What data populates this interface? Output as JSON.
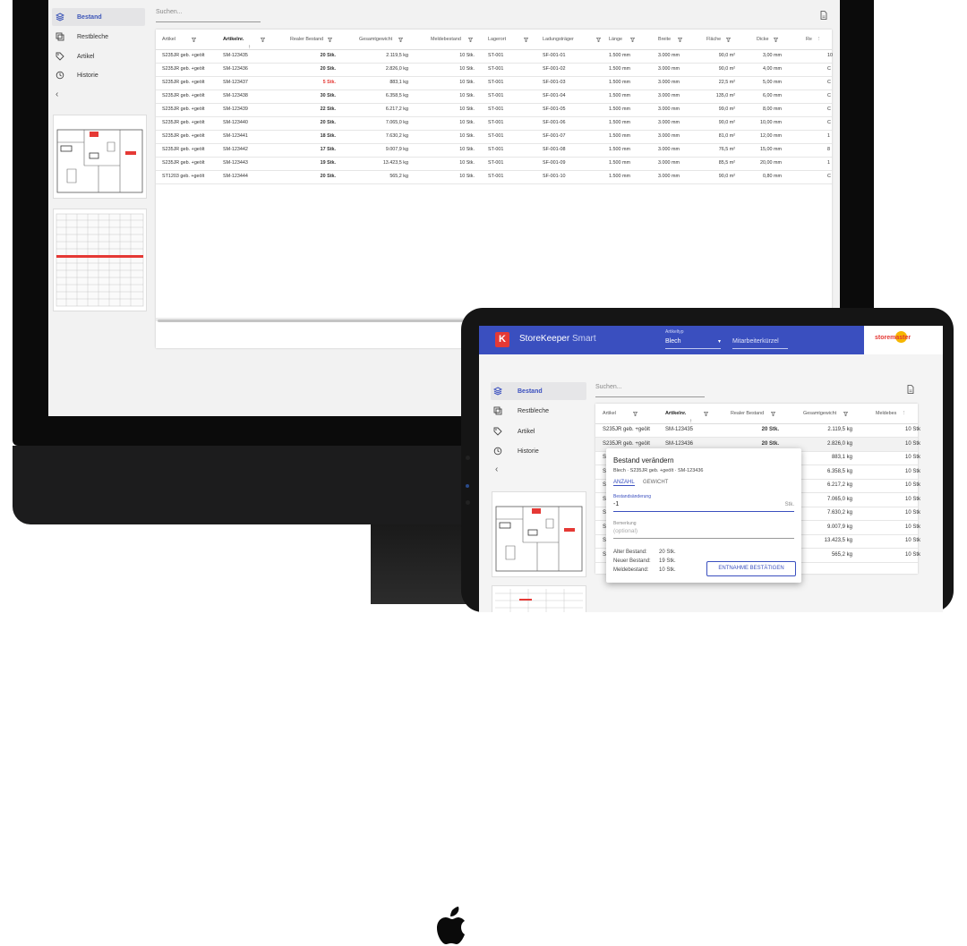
{
  "nav": [
    {
      "label": "Bestand",
      "icon": "layers-icon",
      "active": true
    },
    {
      "label": "Restbleche",
      "icon": "copy-icon",
      "active": false
    },
    {
      "label": "Artikel",
      "icon": "tag-icon",
      "active": false
    },
    {
      "label": "Historie",
      "icon": "history-icon",
      "active": false
    }
  ],
  "collapse_glyph": "‹",
  "search_placeholder": "Suchen...",
  "columns": [
    "Artikel",
    "Artikelnr.",
    "Realer Bestand",
    "Gesamtgewicht",
    "Meldebestand",
    "Lagerort",
    "Ladungsträger",
    "Länge",
    "Breite",
    "Fläche",
    "Dicke",
    "Re"
  ],
  "ipad_columns": [
    "Artikel",
    "Artikelnr.",
    "Realer Bestand",
    "Gesamtgewicht",
    "Meldebes"
  ],
  "rows": [
    {
      "artikel": "S235JR geb. +geölt",
      "nr": "SM-123435",
      "bestand": "20 Stk.",
      "gewicht": "2.119,5 kg",
      "melde": "10 Stk.",
      "lagerort": "ST-001",
      "traeger": "SF-001-01",
      "laenge": "1.500 mm",
      "breite": "3.000 mm",
      "flaeche": "90,0 m²",
      "dicke": "3,00 mm",
      "re": "10",
      "low": false
    },
    {
      "artikel": "S235JR geb. +geölt",
      "nr": "SM-123436",
      "bestand": "20 Stk.",
      "gewicht": "2.826,0 kg",
      "melde": "10 Stk.",
      "lagerort": "ST-001",
      "traeger": "SF-001-02",
      "laenge": "1.500 mm",
      "breite": "3.000 mm",
      "flaeche": "90,0 m²",
      "dicke": "4,00 mm",
      "re": "C",
      "low": false
    },
    {
      "artikel": "S235JR geb. +geölt",
      "nr": "SM-123437",
      "bestand": "5 Stk.",
      "gewicht": "883,1 kg",
      "melde": "10 Stk.",
      "lagerort": "ST-001",
      "traeger": "SF-001-03",
      "laenge": "1.500 mm",
      "breite": "3.000 mm",
      "flaeche": "22,5 m²",
      "dicke": "5,00 mm",
      "re": "C",
      "low": true
    },
    {
      "artikel": "S235JR geb. +geölt",
      "nr": "SM-123438",
      "bestand": "30 Stk.",
      "gewicht": "6.358,5 kg",
      "melde": "10 Stk.",
      "lagerort": "ST-001",
      "traeger": "SF-001-04",
      "laenge": "1.500 mm",
      "breite": "3.000 mm",
      "flaeche": "135,0 m²",
      "dicke": "6,00 mm",
      "re": "C",
      "low": false
    },
    {
      "artikel": "S235JR geb. +geölt",
      "nr": "SM-123439",
      "bestand": "22 Stk.",
      "gewicht": "6.217,2 kg",
      "melde": "10 Stk.",
      "lagerort": "ST-001",
      "traeger": "SF-001-05",
      "laenge": "1.500 mm",
      "breite": "3.000 mm",
      "flaeche": "99,0 m²",
      "dicke": "8,00 mm",
      "re": "C",
      "low": false
    },
    {
      "artikel": "S235JR geb. +geölt",
      "nr": "SM-123440",
      "bestand": "20 Stk.",
      "gewicht": "7.065,0 kg",
      "melde": "10 Stk.",
      "lagerort": "ST-001",
      "traeger": "SF-001-06",
      "laenge": "1.500 mm",
      "breite": "3.000 mm",
      "flaeche": "90,0 m²",
      "dicke": "10,00 mm",
      "re": "C",
      "low": false
    },
    {
      "artikel": "S235JR geb. +geölt",
      "nr": "SM-123441",
      "bestand": "18 Stk.",
      "gewicht": "7.630,2 kg",
      "melde": "10 Stk.",
      "lagerort": "ST-001",
      "traeger": "SF-001-07",
      "laenge": "1.500 mm",
      "breite": "3.000 mm",
      "flaeche": "81,0 m²",
      "dicke": "12,00 mm",
      "re": "1",
      "low": false
    },
    {
      "artikel": "S235JR geb. +geölt",
      "nr": "SM-123442",
      "bestand": "17 Stk.",
      "gewicht": "9.007,9 kg",
      "melde": "10 Stk.",
      "lagerort": "ST-001",
      "traeger": "SF-001-08",
      "laenge": "1.500 mm",
      "breite": "3.000 mm",
      "flaeche": "76,5 m²",
      "dicke": "15,00 mm",
      "re": "8",
      "low": false
    },
    {
      "artikel": "S235JR geb. +geölt",
      "nr": "SM-123443",
      "bestand": "19 Stk.",
      "gewicht": "13.423,5 kg",
      "melde": "10 Stk.",
      "lagerort": "ST-001",
      "traeger": "SF-001-09",
      "laenge": "1.500 mm",
      "breite": "3.000 mm",
      "flaeche": "85,5 m²",
      "dicke": "20,00 mm",
      "re": "1",
      "low": false
    },
    {
      "artikel": "ST1203 geb. +geölt",
      "nr": "SM-123444",
      "bestand": "20 Stk.",
      "gewicht": "565,2 kg",
      "melde": "10 Stk.",
      "lagerort": "ST-001",
      "traeger": "SF-001-10",
      "laenge": "1.500 mm",
      "breite": "3.000 mm",
      "flaeche": "90,0 m²",
      "dicke": "0,80 mm",
      "re": "C",
      "low": false
    }
  ],
  "ipad_rows_first_col": [
    "S235JR geb. +geölt",
    "S235JR geb. +geölt",
    "S",
    "S",
    "S",
    "S",
    "S",
    "S",
    "S",
    "S"
  ],
  "ipad_melde_col": [
    "10 Stk",
    "10 Stk",
    "10 Stk",
    "10 Stk",
    "10 Stk",
    "10 Stk",
    "10 Stk",
    "10 Stk",
    "10 Stk",
    "10 Stk"
  ],
  "header": {
    "logo_letter": "K",
    "app_name": "StoreKeeper",
    "app_suffix": "Smart",
    "artikeltyp_label": "Artikeltyp",
    "artikeltyp_value": "Blech",
    "caret": "▾",
    "kuerzel_placeholder": "Mitarbeiterkürzel",
    "brand": "storemaster"
  },
  "dialog": {
    "title": "Bestand verändern",
    "subtitle": "Blech · S235JR geb. +geölt · SM-123436",
    "tab_anzahl": "ANZAHL",
    "tab_gewicht": "GEWICHT",
    "field_label": "Bestandsänderung",
    "field_value": "-1",
    "field_unit": "Stk.",
    "bemerkung_label": "Bemerkung",
    "bemerkung_placeholder": "(optional)",
    "alter_label": "Alter Bestand:",
    "alter_value": "20 Stk.",
    "neuer_label": "Neuer Bestand:",
    "neuer_value": "19 Stk.",
    "melde_label": "Meldebestand:",
    "melde_value": "10 Stk.",
    "confirm": "ENTNAHME BESTÄTIGEN"
  },
  "colors": {
    "accent": "#3a4fbf",
    "warning": "#e53935",
    "brand_sun": "#f6b600"
  }
}
